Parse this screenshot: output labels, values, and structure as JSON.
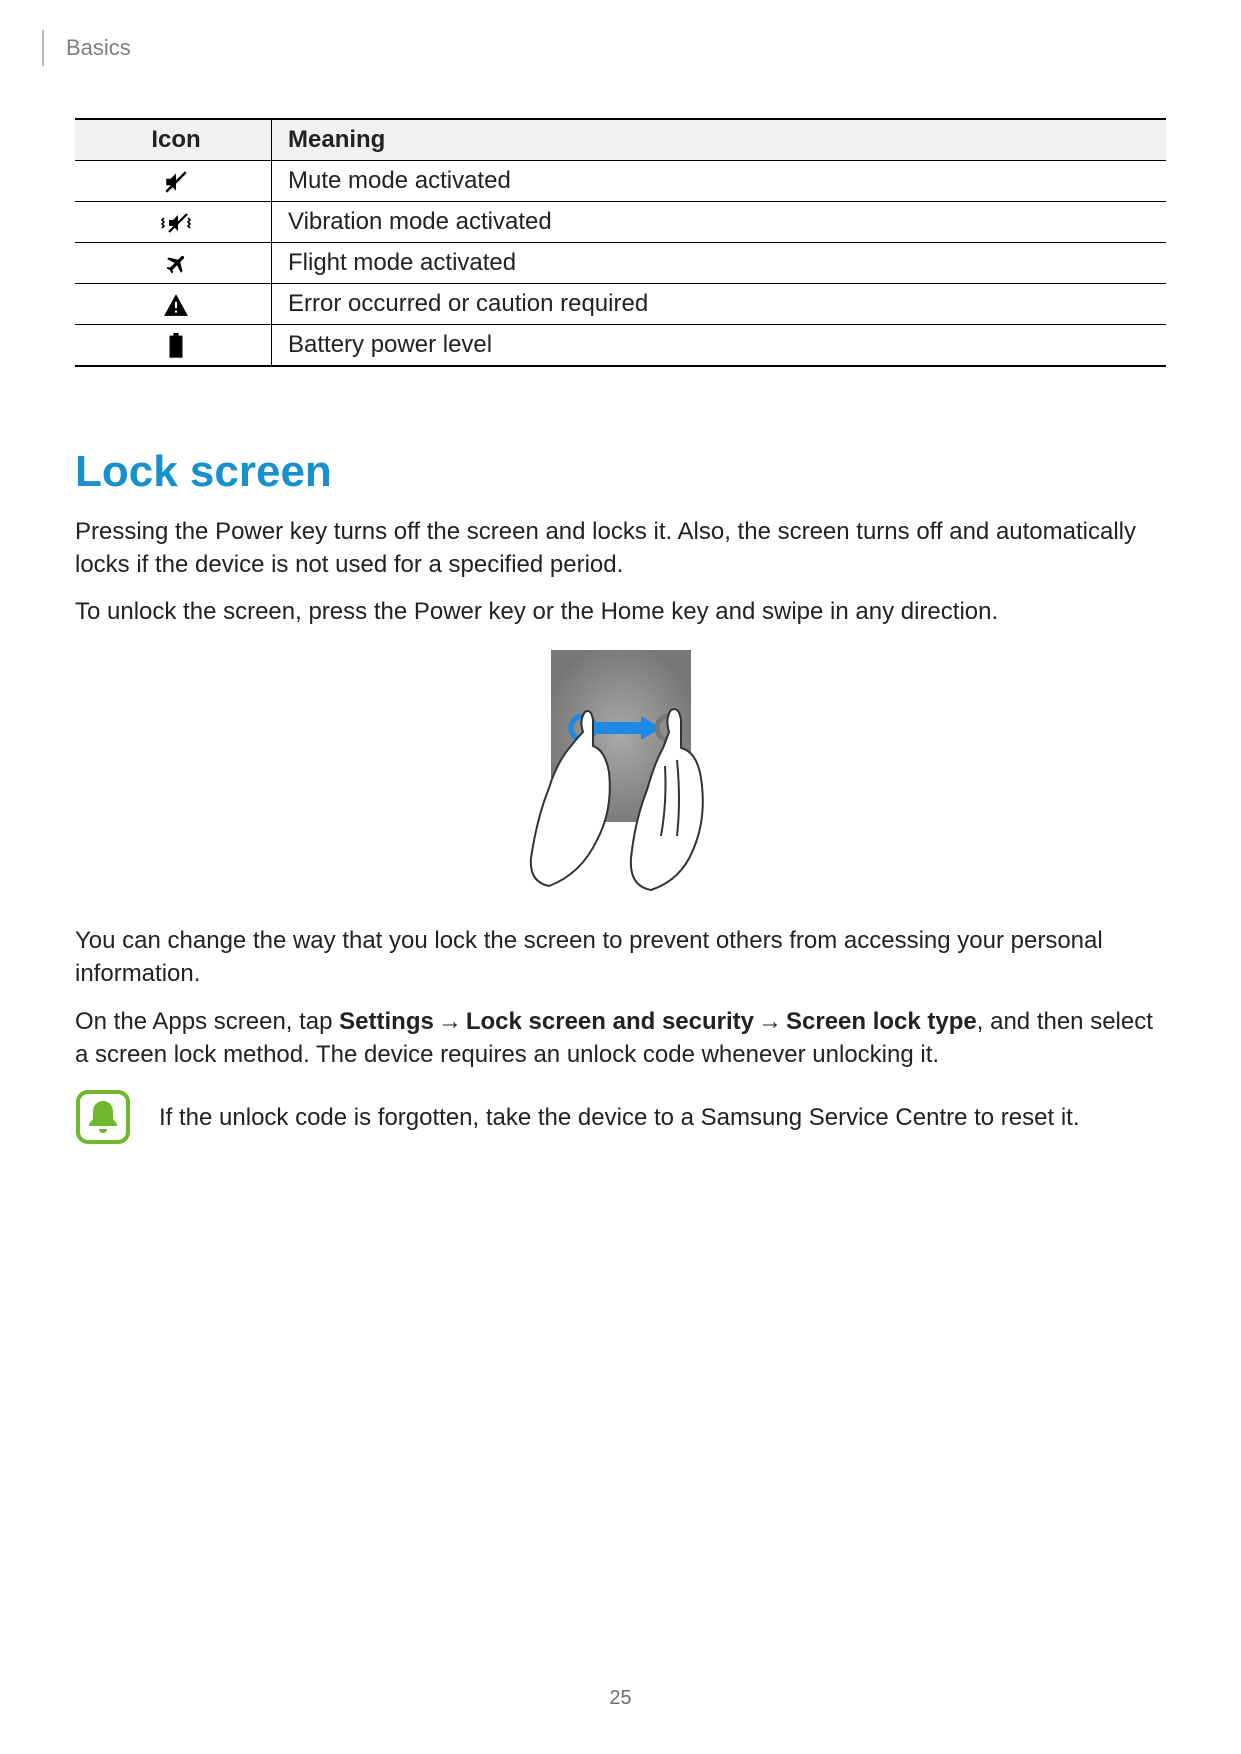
{
  "breadcrumb": "Basics",
  "table": {
    "headers": {
      "icon": "Icon",
      "meaning": "Meaning"
    },
    "rows": [
      {
        "icon_name": "mute-icon",
        "meaning": "Mute mode activated"
      },
      {
        "icon_name": "vibrate-icon",
        "meaning": "Vibration mode activated"
      },
      {
        "icon_name": "airplane-icon",
        "meaning": "Flight mode activated"
      },
      {
        "icon_name": "warning-icon",
        "meaning": "Error occurred or caution required"
      },
      {
        "icon_name": "battery-icon",
        "meaning": "Battery power level"
      }
    ]
  },
  "section": {
    "heading": "Lock screen",
    "para1": "Pressing the Power key turns off the screen and locks it. Also, the screen turns off and automatically locks if the device is not used for a specified period.",
    "para2": "To unlock the screen, press the Power key or the Home key and swipe in any direction.",
    "para3": "You can change the way that you lock the screen to prevent others from accessing your personal information.",
    "instruction": {
      "lead": "On the Apps screen, tap ",
      "step1": "Settings",
      "arrow": "→",
      "step2": "Lock screen and security",
      "step3": "Screen lock type",
      "tail": ", and then select a screen lock method. The device requires an unlock code whenever unlocking it."
    },
    "note": "If the unlock code is forgotten, take the device to a Samsung Service Centre to reset it."
  },
  "page_number": "25"
}
